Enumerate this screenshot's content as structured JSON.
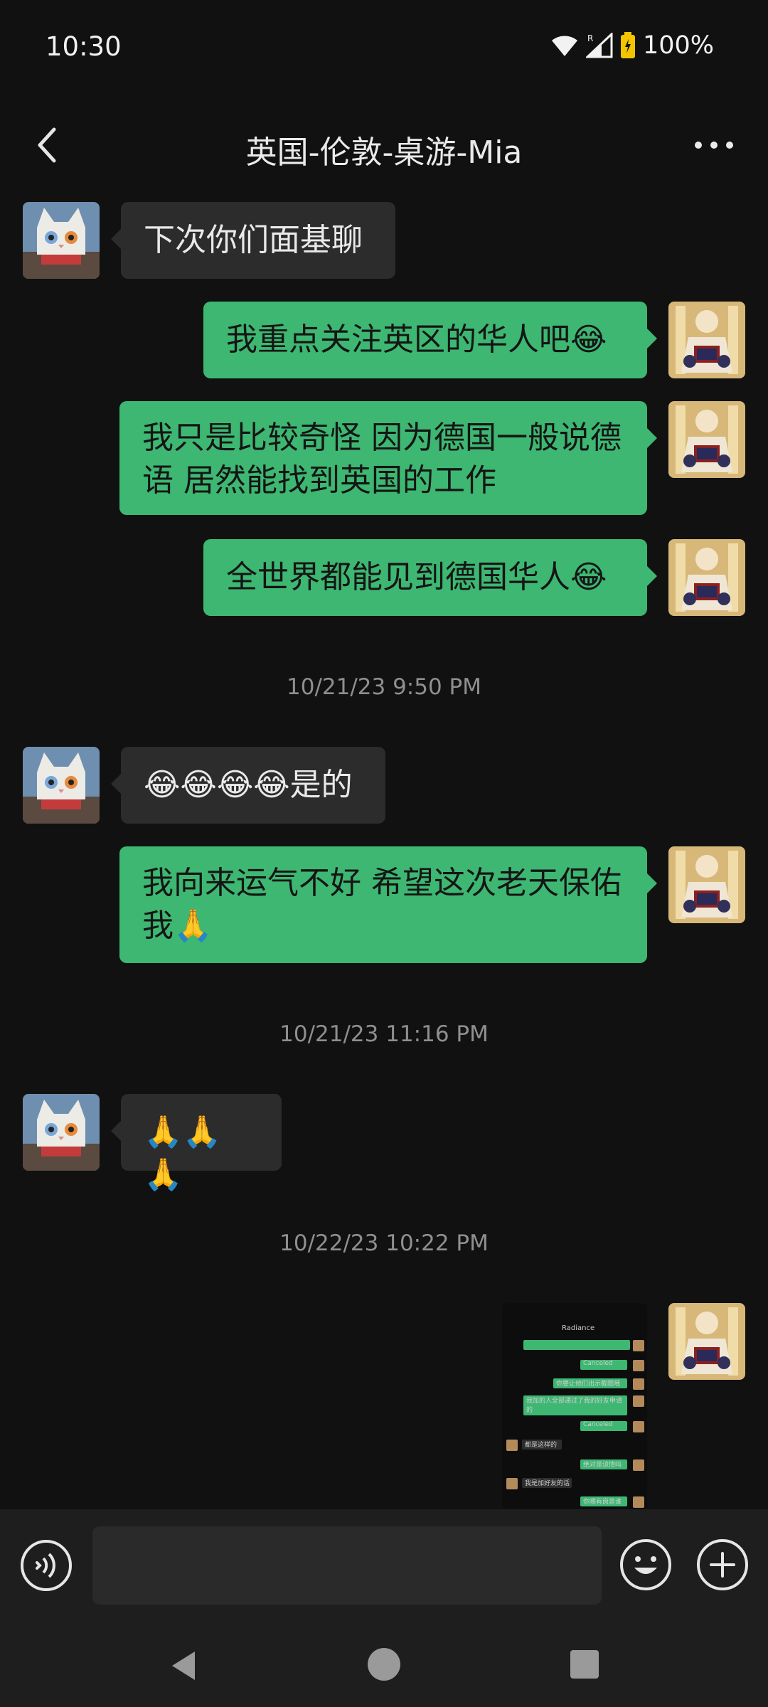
{
  "status_bar": {
    "time": "10:30",
    "battery": "100%",
    "icons": [
      "wifi-icon",
      "signal-icon",
      "battery-icon"
    ]
  },
  "header": {
    "title": "英国-伦敦-桌游-Mia",
    "back_icon": "chevron-left-icon",
    "more_icon": "more-dots-icon"
  },
  "messages": [
    {
      "side": "in",
      "text": "下次你们面基聊"
    },
    {
      "side": "out",
      "text": "我重点关注英区的华人吧😂"
    },
    {
      "side": "out",
      "text": "我只是比较奇怪 因为德国一般说德\n语 居然能找到英国的工作"
    },
    {
      "side": "out",
      "text": "全世界都能见到德国华人😂"
    },
    {
      "type": "time",
      "text": "10/21/23 9:50 PM"
    },
    {
      "side": "in",
      "text": "😂😂😂😂是的"
    },
    {
      "side": "out",
      "text": "我向来运气不好 希望这次老天保佑\n我🙏"
    },
    {
      "type": "time",
      "text": "10/21/23 11:16 PM"
    },
    {
      "side": "in",
      "text": "🙏🙏🙏"
    },
    {
      "type": "time",
      "text": "10/22/23 10:22 PM"
    }
  ],
  "screenshot_thumb": {
    "title": "Radiance",
    "lines": [
      "Canceled",
      "你要让他们出示截图哦",
      "我加的人全部通过了我的好友申请的",
      "Canceled",
      "都是这样的",
      "绝对是谅情吗",
      "我是加好友的话",
      "你哪有岗是谁"
    ]
  },
  "input_bar": {
    "placeholder": "",
    "voice_icon": "voice-icon",
    "emoji_icon": "emoji-icon",
    "plus_icon": "plus-icon"
  },
  "nav_bar": {
    "icons": [
      "nav-back-icon",
      "nav-home-icon",
      "nav-recents-icon"
    ]
  },
  "colors": {
    "background": "#111111",
    "outgoing_bubble": "#3db772",
    "incoming_bubble": "#2c2c2c"
  }
}
